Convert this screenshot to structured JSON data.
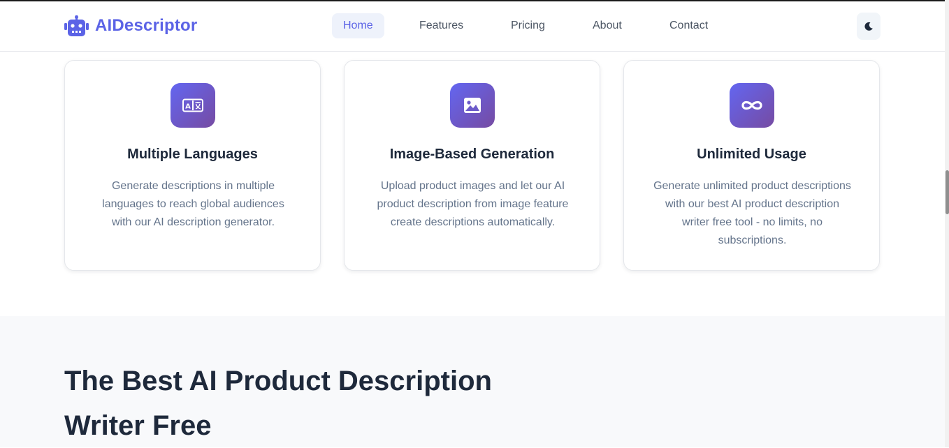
{
  "brand": {
    "name": "AIDescriptor",
    "icon": "robot-icon",
    "color": "#5b63e6"
  },
  "nav": {
    "items": [
      {
        "label": "Home",
        "active": true
      },
      {
        "label": "Features",
        "active": false
      },
      {
        "label": "Pricing",
        "active": false
      },
      {
        "label": "About",
        "active": false
      },
      {
        "label": "Contact",
        "active": false
      }
    ]
  },
  "theme_toggle": {
    "icon": "moon-icon"
  },
  "features": [
    {
      "icon": "language-icon",
      "title": "Multiple Languages",
      "text": "Generate descriptions in multiple languages to reach global audiences with our AI description generator."
    },
    {
      "icon": "image-icon",
      "title": "Image-Based Generation",
      "text": "Upload product images and let our AI product description from image feature create descriptions automatically."
    },
    {
      "icon": "infinity-icon",
      "title": "Unlimited Usage",
      "text": "Generate unlimited product descriptions with our best AI product description writer free tool - no limits, no subscriptions."
    }
  ],
  "section": {
    "headline": "The Best AI Product Description Writer Free"
  },
  "colors": {
    "accent": "#5b63e6",
    "icon_gradient_start": "#6366f1",
    "icon_gradient_end": "#764ba2",
    "section_bg": "#f8f9fb"
  }
}
